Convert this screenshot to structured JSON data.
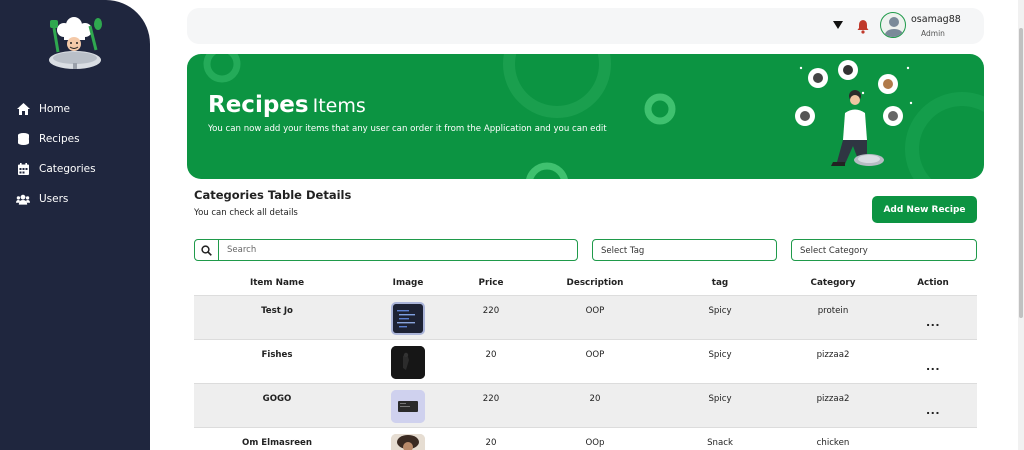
{
  "sidebar": {
    "items": [
      {
        "label": "Home",
        "icon": "home-icon"
      },
      {
        "label": "Recipes",
        "icon": "database-icon"
      },
      {
        "label": "Categories",
        "icon": "calendar-icon"
      },
      {
        "label": "Users",
        "icon": "users-icon"
      }
    ]
  },
  "header": {
    "username": "osamag88",
    "role": "Admin"
  },
  "banner": {
    "title_bold": "Recipes",
    "title_light": "Items",
    "subtitle": "You can now add your items that any user can order it from the Application and you can edit"
  },
  "section": {
    "title": "Categories Table Details",
    "subtitle": "You can check all details",
    "add_button": "Add New Recipe"
  },
  "filters": {
    "search_placeholder": "Search",
    "tag_placeholder": "Select Tag",
    "category_placeholder": "Select Category"
  },
  "table": {
    "headers": [
      "Item Name",
      "Image",
      "Price",
      "Description",
      "tag",
      "Category",
      "Action"
    ],
    "rows": [
      {
        "name": "Test Jo",
        "price": "220",
        "description": "OOP",
        "tag": "Spicy",
        "category": "protein",
        "action": "..."
      },
      {
        "name": "Fishes",
        "price": "20",
        "description": "OOP",
        "tag": "Spicy",
        "category": "pizzaa2",
        "action": "..."
      },
      {
        "name": "GOGO",
        "price": "220",
        "description": "20",
        "tag": "Spicy",
        "category": "pizzaa2",
        "action": "..."
      },
      {
        "name": "Om Elmasreen",
        "price": "20",
        "description": "OOp",
        "tag": "Snack",
        "category": "chicken",
        "action": "..."
      }
    ]
  },
  "colors": {
    "sidebar_bg": "#1f263e",
    "brand_green": "#0c9442",
    "row_alt": "#eeeeee"
  }
}
